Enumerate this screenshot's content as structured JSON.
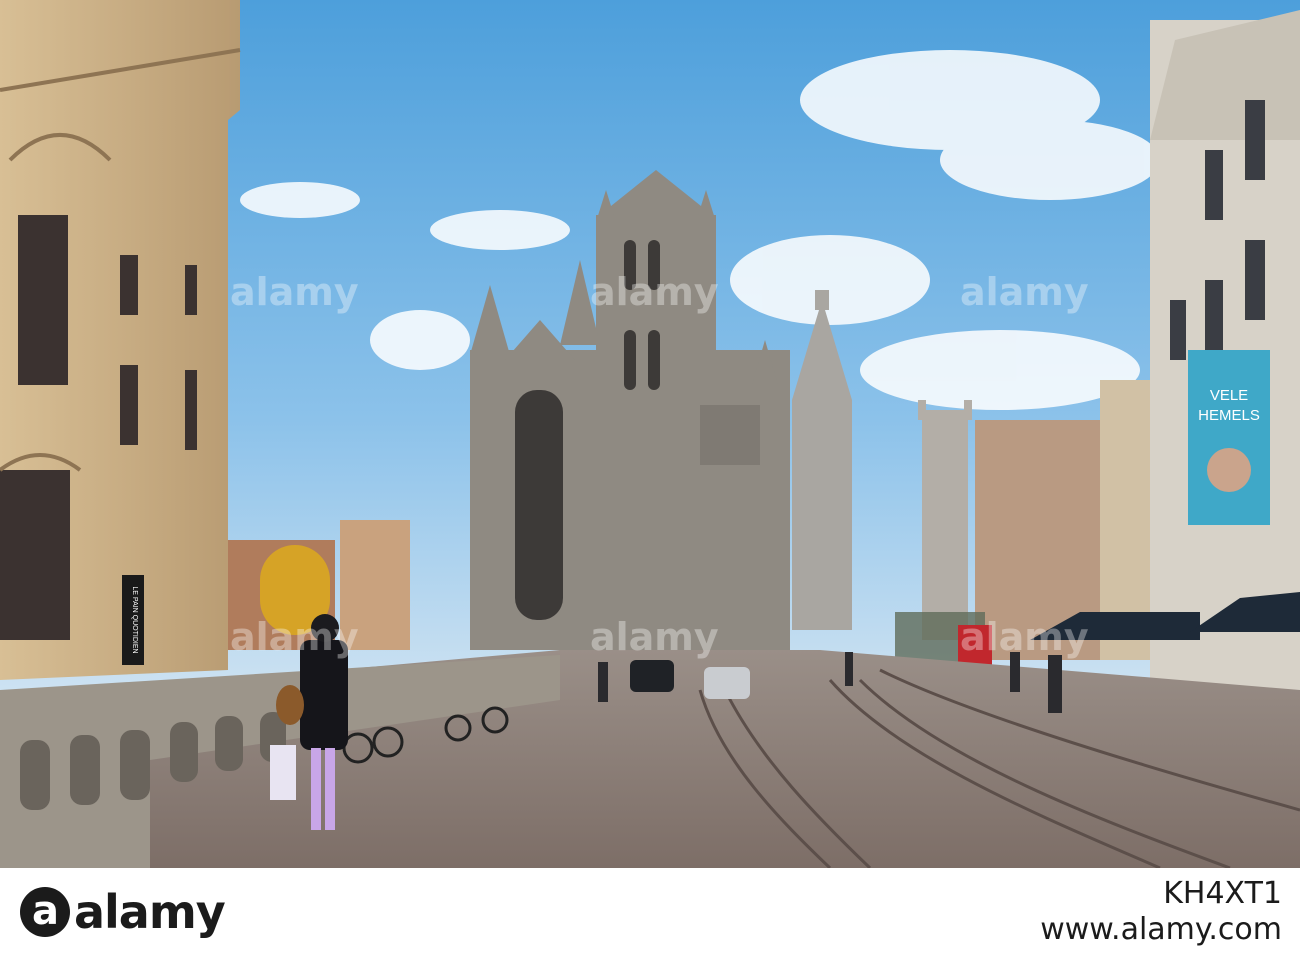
{
  "photo": {
    "description_colors": {
      "sky": "#5aa8de",
      "stone": "#8f8a82",
      "cobble": "#8a7c74"
    },
    "sign_le_pain": "LE PAIN QUOTIDIEN",
    "billboard_line1": "VELE",
    "billboard_line2": "HEMELS",
    "watermark": "alamy"
  },
  "footer": {
    "logo_text": "alamy",
    "image_id": "KH4XT1",
    "site": "www.alamy.com"
  }
}
